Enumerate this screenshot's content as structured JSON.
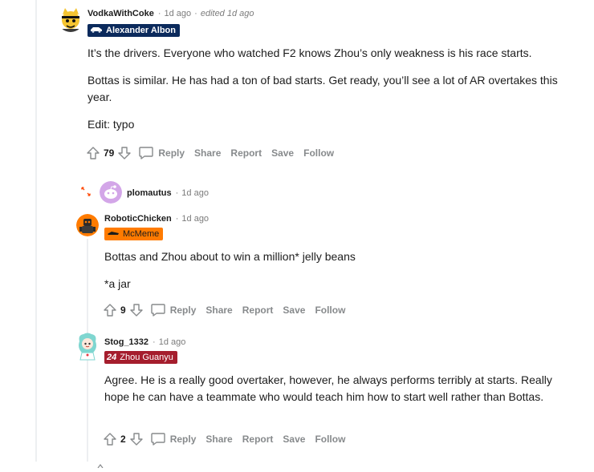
{
  "comments": [
    {
      "username": "VodkaWithCoke",
      "time": "1d ago",
      "edited": "edited 1d ago",
      "flair": "Alexander Albon",
      "paragraphs": [
        "It’s the drivers. Everyone who watched F2 knows Zhou’s only weakness is his race starts.",
        "Bottas is similar. He has had a ton of bad starts. Get ready, you’ll see a lot of AR overtakes this year.",
        "Edit: typo"
      ],
      "score": "79"
    },
    {
      "username": "plomautus",
      "time": "1d ago"
    },
    {
      "username": "RoboticChicken",
      "time": "1d ago",
      "flair": "McMeme",
      "paragraphs": [
        "Bottas and Zhou about to win a million* jelly beans",
        "*a jar"
      ],
      "score": "9"
    },
    {
      "username": "Stog_1332",
      "time": "1d ago",
      "flair_number": "24",
      "flair": "Zhou Guanyu",
      "paragraphs": [
        "Agree. He is a really good overtaker, however, he always performs terribly at starts. Really hope he can have a teammate who would teach him how to start well rather than Bottas."
      ],
      "score": "2"
    }
  ],
  "actions": {
    "reply": "Reply",
    "share": "Share",
    "report": "Report",
    "save": "Save",
    "follow": "Follow"
  },
  "meta_separator": "·",
  "colors": {
    "albon_flair_bg": "#0b2a5c",
    "mcmeme_flair_bg": "#ff7b00",
    "zhou_flair_bg": "#a51d2d",
    "thread_line": "#edeff1",
    "muted": "#878a8c"
  }
}
